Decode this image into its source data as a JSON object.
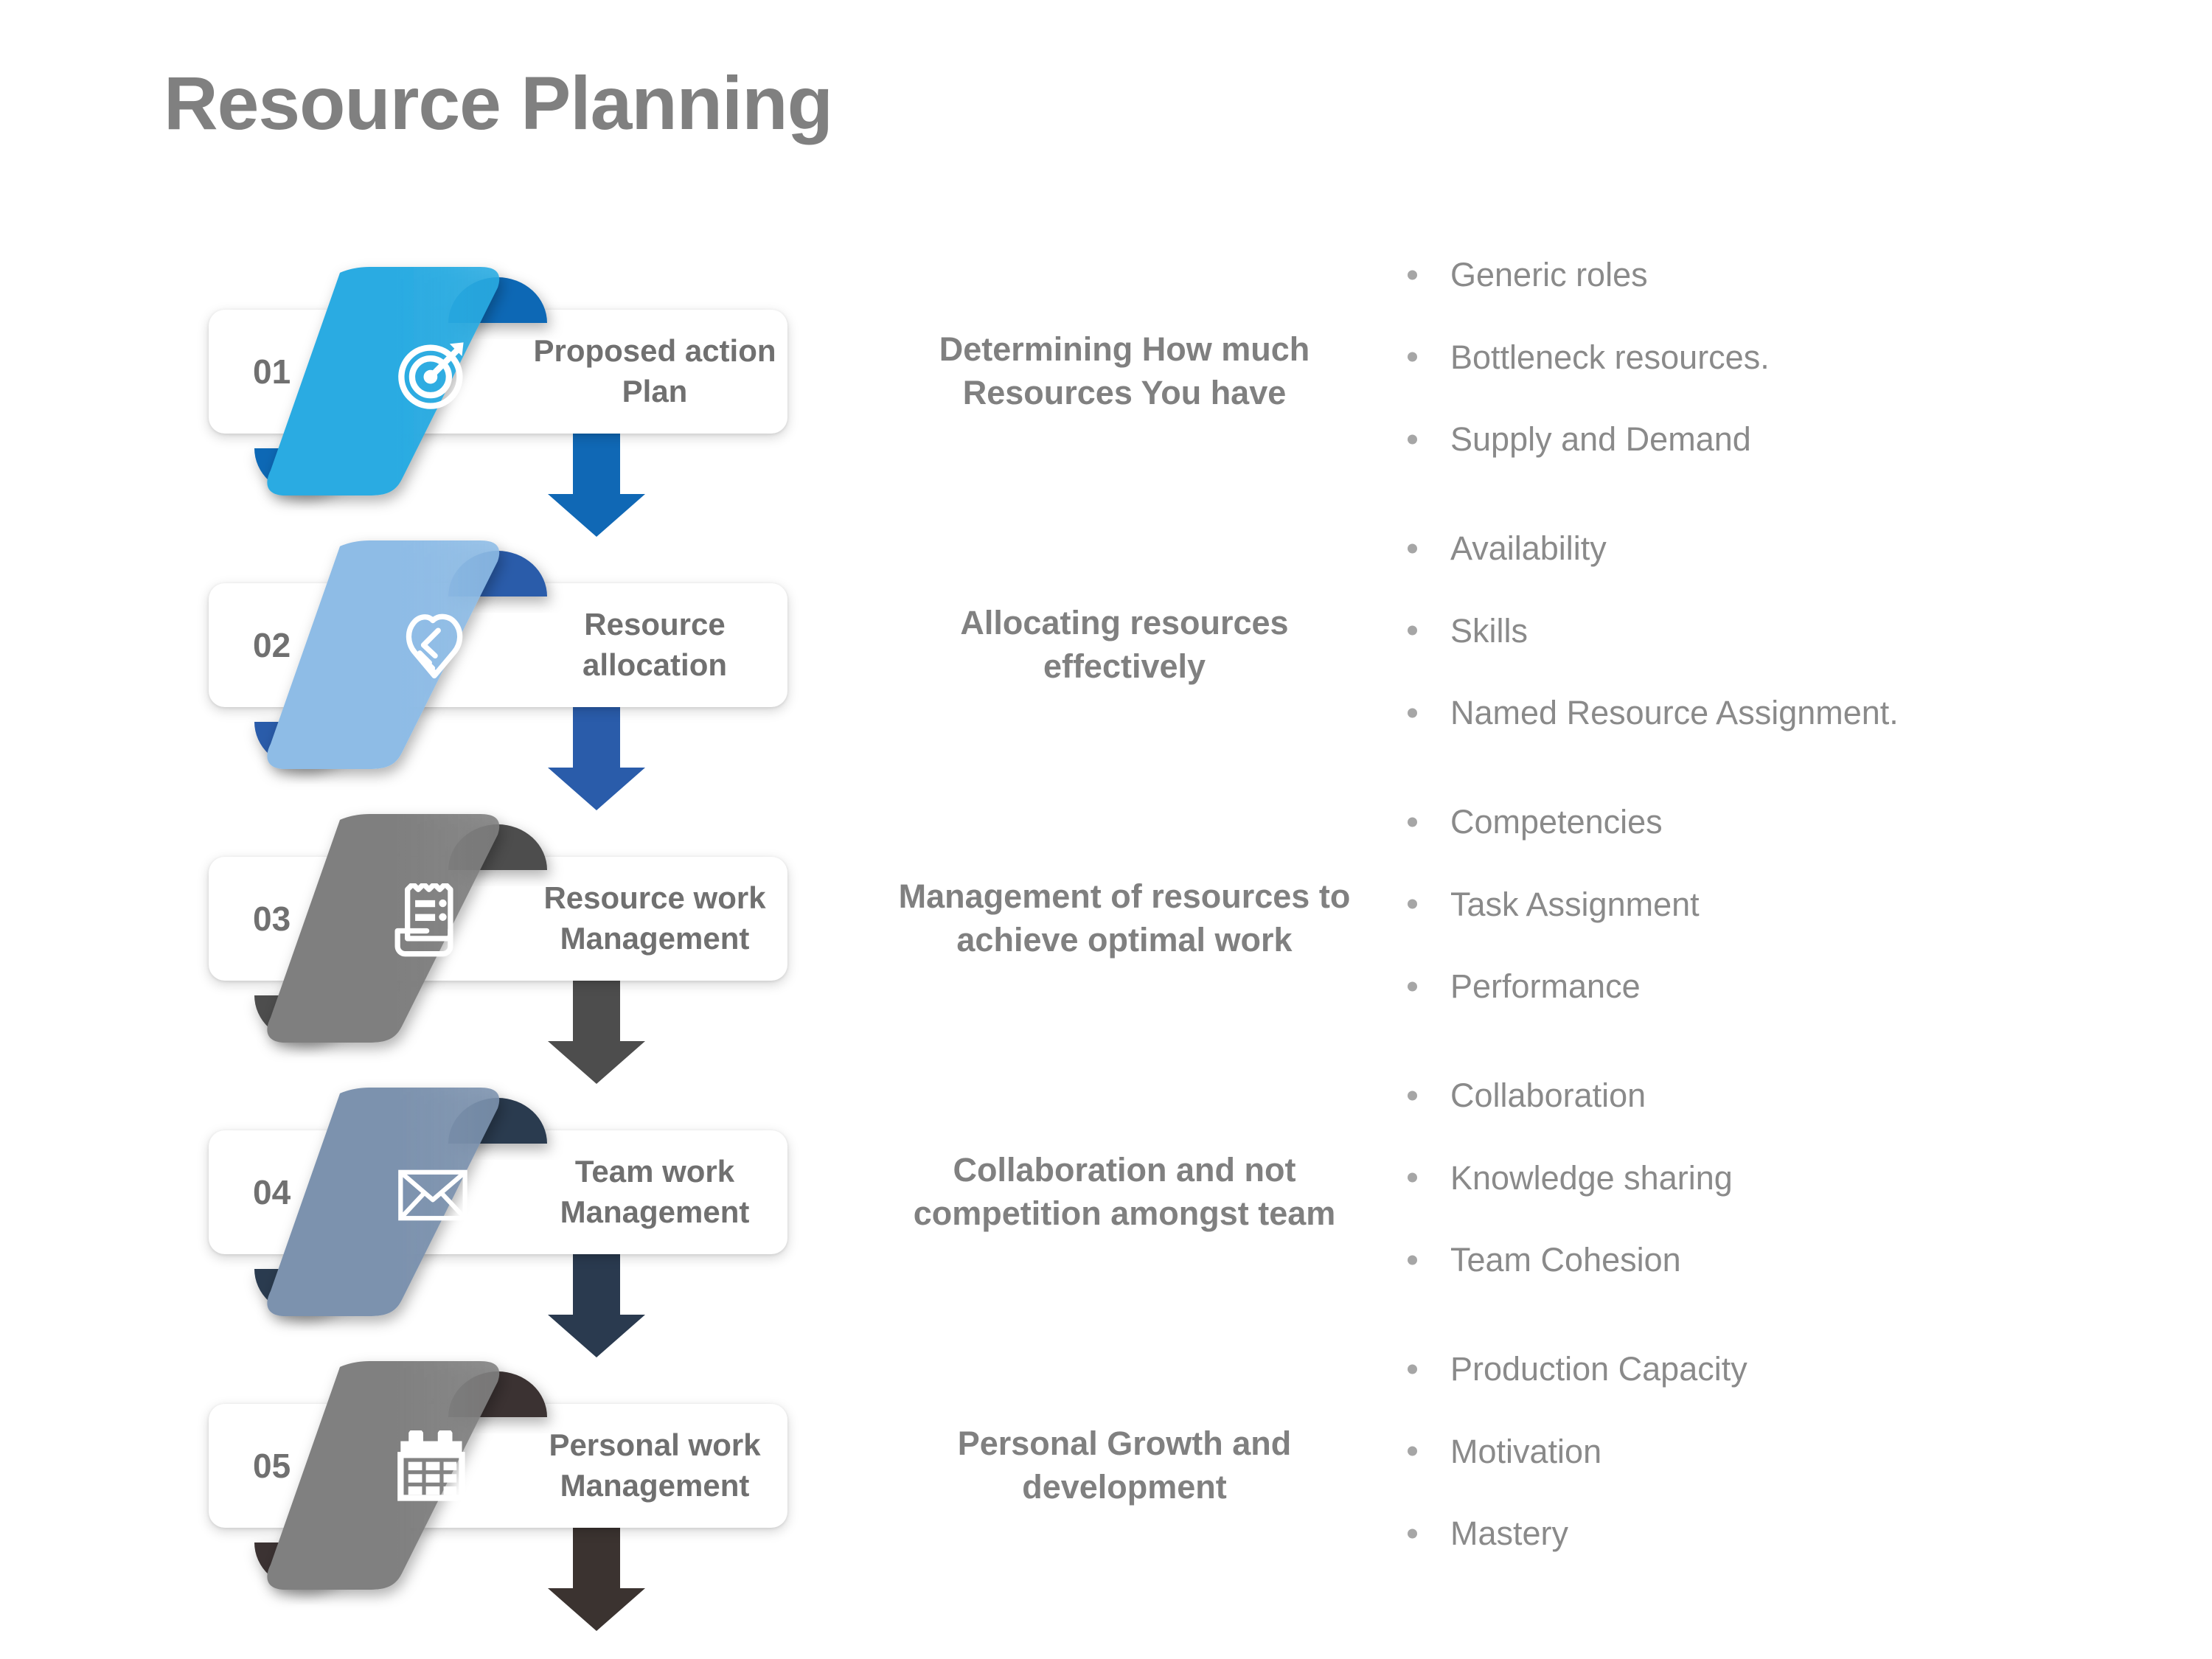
{
  "page": {
    "title": "Resource Planning",
    "title_color": "#808080",
    "background": "#ffffff"
  },
  "steps": [
    {
      "number": "01",
      "label": "Proposed action Plan",
      "icon": "target-icon",
      "ribbon_color": "#29ABE2",
      "fold_color": "#1068B5",
      "arrow_color": "#1068B5",
      "description": "Determining How much Resources You have",
      "bullets": [
        "Generic roles",
        "Bottleneck resources.",
        "Supply and Demand"
      ]
    },
    {
      "number": "02",
      "label": "Resource allocation",
      "icon": "handshake-icon",
      "ribbon_color": "#8EBCE6",
      "fold_color": "#2A5CAA",
      "arrow_color": "#2A5CAA",
      "description": "Allocating resources effectively",
      "bullets": [
        "Availability",
        "Skills",
        "Named Resource Assignment."
      ]
    },
    {
      "number": "03",
      "label": "Resource work Management",
      "icon": "receipt-icon",
      "ribbon_color": "#7F7F7F",
      "fold_color": "#4D4D4D",
      "arrow_color": "#4D4D4D",
      "description": "Management of resources to achieve optimal work",
      "bullets": [
        "Competencies",
        "Task Assignment",
        "Performance"
      ]
    },
    {
      "number": "04",
      "label": "Team work Management",
      "icon": "envelope-icon",
      "ribbon_color": "#7C92AE",
      "fold_color": "#2A3A4F",
      "arrow_color": "#2A3A4F",
      "description": "Collaboration and not competition amongst team",
      "bullets": [
        "Collaboration",
        "Knowledge sharing",
        "Team Cohesion"
      ]
    },
    {
      "number": "05",
      "label": "Personal work Management",
      "icon": "calendar-icon",
      "ribbon_color": "#808080",
      "fold_color": "#3B3330",
      "arrow_color": "#3B3330",
      "description": "Personal Growth and development",
      "bullets": [
        "Production Capacity",
        "Motivation",
        "Mastery"
      ]
    }
  ]
}
